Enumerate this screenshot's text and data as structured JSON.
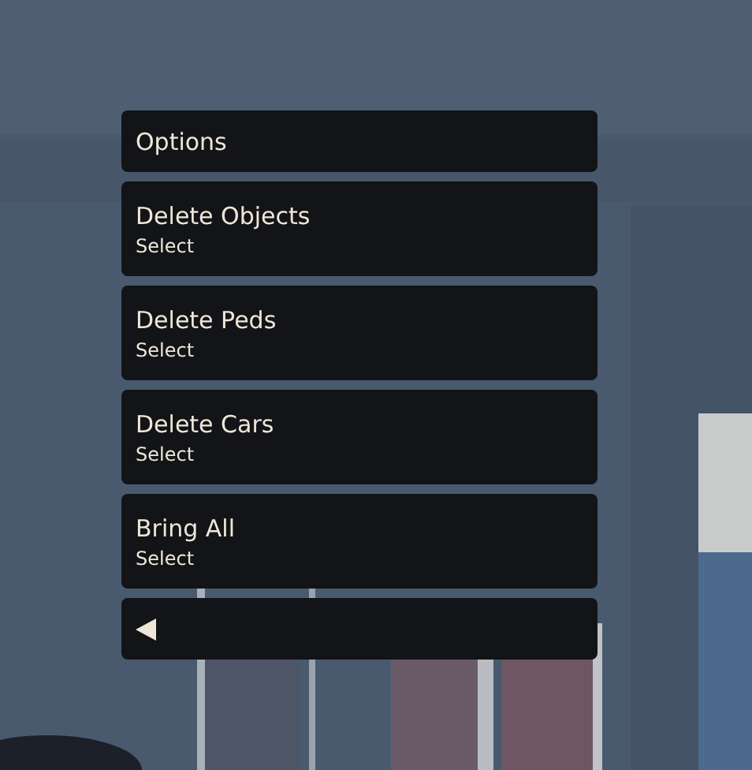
{
  "menu": {
    "title": "Options",
    "items": [
      {
        "label": "Delete Objects",
        "sublabel": "Select"
      },
      {
        "label": "Delete Peds",
        "sublabel": "Select"
      },
      {
        "label": "Delete Cars",
        "sublabel": "Select"
      },
      {
        "label": "Bring All",
        "sublabel": "Select"
      }
    ]
  }
}
